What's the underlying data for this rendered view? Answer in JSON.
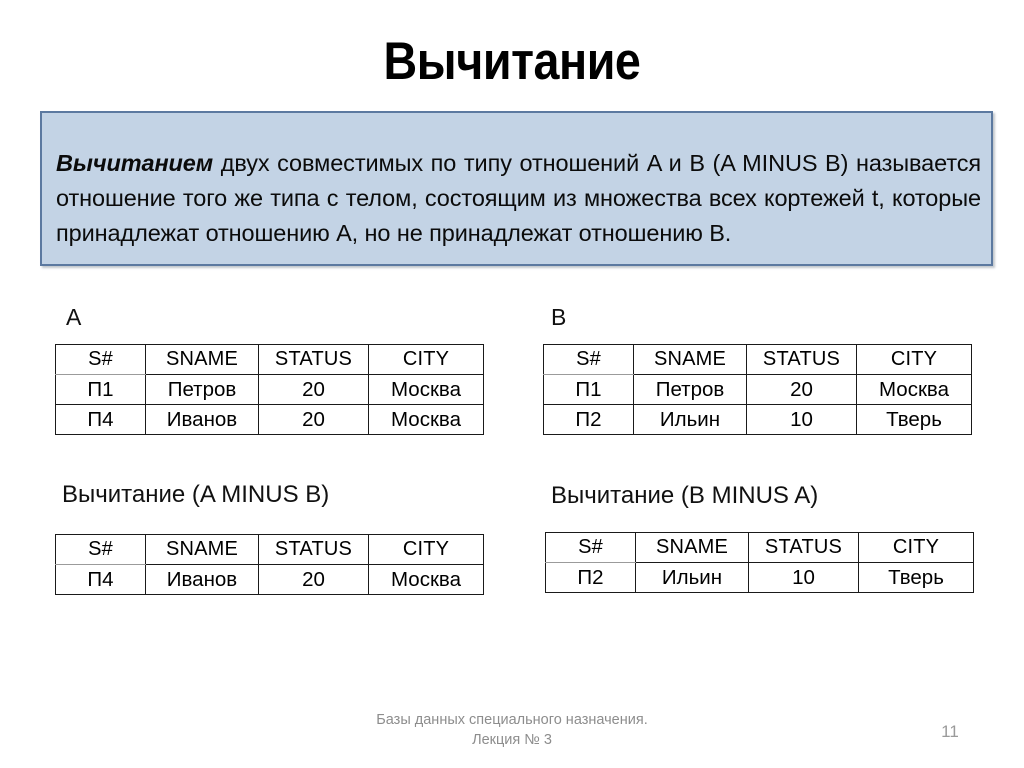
{
  "slide": {
    "title": "Вычитание",
    "page_number": "11"
  },
  "definition": {
    "lead_term": "Вычитанием",
    "body": " двух совместимых по типу отношений A и B (A MINUS B) называется отношение того же типа с телом, состоящим из множества всех кортежей t, которые принадлежат отношению A, но не принадлежат отношению B.",
    "box_fill": "#c3d3e5",
    "box_border": "#5c79a0"
  },
  "relations": {
    "a": {
      "label": "A",
      "columns": [
        "S#",
        "SNAME",
        "STATUS",
        "CITY"
      ],
      "rows": [
        [
          "П1",
          "Петров",
          "20",
          "Москва"
        ],
        [
          "П4",
          "Иванов",
          "20",
          "Москва"
        ]
      ]
    },
    "b": {
      "label": "B",
      "columns": [
        "S#",
        "SNAME",
        "STATUS",
        "CITY"
      ],
      "rows": [
        [
          "П1",
          "Петров",
          "20",
          "Москва"
        ],
        [
          "П2",
          "Ильин",
          "10",
          "Тверь"
        ]
      ]
    },
    "a_minus_b": {
      "label": "Вычитание (A MINUS B)",
      "columns": [
        "S#",
        "SNAME",
        "STATUS",
        "CITY"
      ],
      "rows": [
        [
          "П4",
          "Иванов",
          "20",
          "Москва"
        ]
      ]
    },
    "b_minus_a": {
      "label": "Вычитание (B MINUS A)",
      "columns": [
        "S#",
        "SNAME",
        "STATUS",
        "CITY"
      ],
      "rows": [
        [
          "П2",
          "Ильин",
          "10",
          "Тверь"
        ]
      ]
    }
  },
  "footer": {
    "line1": "Базы данных специального назначения.",
    "line2": "Лекция № 3"
  }
}
